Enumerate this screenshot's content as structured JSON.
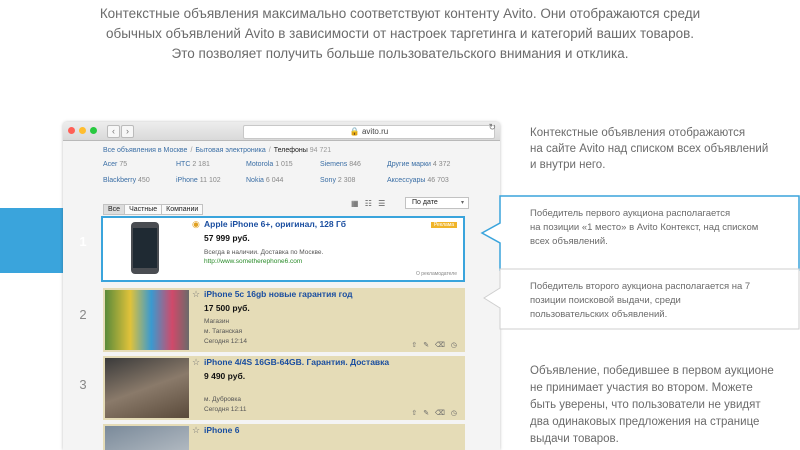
{
  "intro": {
    "line1": "Контекстные объявления максимально соответствуют контенту Avito. Они отображаются среди",
    "line2": "обычных объявлений Avito в зависимости от настроек таргетинга и категорий ваших товаров.",
    "line3": "Это позволяет получить больше пользовательского внимания и отклика."
  },
  "browser": {
    "url": "avito.ru",
    "back": "‹",
    "forward": "›",
    "reload": "↻",
    "dot_colors": [
      "#ff5f56",
      "#ffbd2e",
      "#27c93f"
    ]
  },
  "breadcrumbs": {
    "all": "Все объявления в Москве",
    "electronics": "Бытовая электроника",
    "current": "Телефоны",
    "count": "94 721"
  },
  "categories": [
    {
      "name": "Acer",
      "count": "75"
    },
    {
      "name": "HTC",
      "count": "2 181"
    },
    {
      "name": "Motorola",
      "count": "1 015"
    },
    {
      "name": "Siemens",
      "count": "846"
    },
    {
      "name": "Другие марки",
      "count": "4 372"
    },
    {
      "name": "Blackberry",
      "count": "450"
    },
    {
      "name": "iPhone",
      "count": "11 102"
    },
    {
      "name": "Nokia",
      "count": "6 044"
    },
    {
      "name": "Sony",
      "count": "2 308"
    },
    {
      "name": "Аксессуары",
      "count": "46 703"
    }
  ],
  "filters": {
    "all": "Все",
    "private": "Частные",
    "companies": "Компании"
  },
  "sort": {
    "label": "По дате",
    "arrow": "▾"
  },
  "views_icons": "▦ ☷ ☰",
  "row_numbers": {
    "first": "1",
    "second": "2",
    "third": "3"
  },
  "listings": [
    {
      "title": "Apple iPhone 6+, оригинал, 128 Гб",
      "price": "57 999 руб.",
      "meta1": "Всегда в наличии. Доставка по Москве.",
      "link": "http://www.sometherephone6.com",
      "badge": "Реклама",
      "note": "О рекламодателе"
    },
    {
      "title": "iPhone 5c 16gb новые гарантия год",
      "price": "17 500 руб.",
      "meta1": "Магазин",
      "meta2": "м. Таганская",
      "meta3": "Сегодня 12:14"
    },
    {
      "title": "iPhone 4/4S 16GB-64GB. Гарантия. Доставка",
      "price": "9 490 руб.",
      "meta1": "м. Дубровка",
      "meta2": "Сегодня 12:11"
    },
    {
      "title": "iPhone 6"
    }
  ],
  "actions_icons": "⇧ ✎ ⌫ ◷",
  "callouts": {
    "desc1": [
      "Контекстные объявления отображаются",
      "на сайте Avito над списком всех объявлений",
      "и внутри него."
    ],
    "first": [
      "Победитель первого аукциона располагается",
      "на позиции «1 место» в Avito Контекст, над списком",
      "всех объявлений."
    ],
    "second": [
      "Победитель второго аукциона располагается на 7",
      "позиции поисковой выдачи, среди",
      "пользовательских объявлений."
    ],
    "desc4": [
      "Объявление, победившее в первом аукционе",
      "не принимает участия во втором. Можете",
      "быть уверены, что пользователи не увидят",
      "два одинаковых предложения на странице",
      "выдачи товаров."
    ]
  },
  "colors": {
    "accent": "#3aa4dc",
    "listing_bg": "#e5dcb7",
    "link": "#1a4ea0",
    "badge": "#f0b429"
  }
}
